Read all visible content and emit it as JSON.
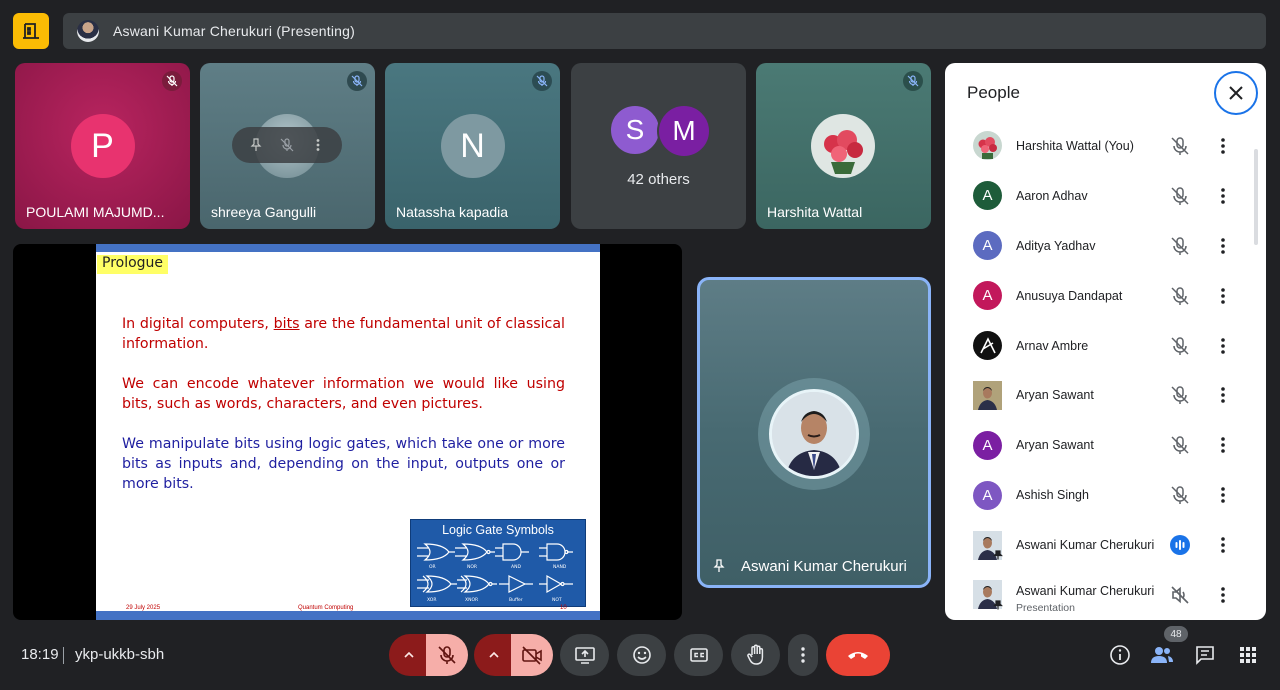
{
  "header": {
    "presenting_label": "Aswani Kumar Cherukuri (Presenting)"
  },
  "tiles": [
    {
      "name": "POULAMI MAJUMD...",
      "initial": "P",
      "bg": "#9c1a4f",
      "avatar_color": "#e8336f"
    },
    {
      "name": "shreeya Gangulli",
      "initial": "",
      "bg": "#4d6a72",
      "avatar_color": "#7a9aa4"
    },
    {
      "name": "Natassha kapadia",
      "initial": "N",
      "bg": "#3f6b75",
      "avatar_color": "#7e99a1"
    },
    {
      "name": "",
      "others_label": "42 others",
      "initials": [
        "S",
        "M"
      ],
      "bg": "#3c4043"
    },
    {
      "name": "Harshita Wattal",
      "bg": "#3e6a66"
    }
  ],
  "slide": {
    "tag": "Prologue",
    "para1": "In digital computers, bits are the fundamental unit of classical information.",
    "para1_pre": "In digital computers, ",
    "para1_bits": "bits",
    "para1_post": " are the fundamental unit of classical information.",
    "para2": "We can encode whatever information we would like using bits, such as words, characters, and even pictures.",
    "para3": "We manipulate bits using logic gates, which take one or more bits as inputs and, depending on the input, outputs one or more bits.",
    "gates_title": "Logic Gate Symbols",
    "gate_labels_row1": [
      "OR",
      "NOR",
      "AND",
      "NAND"
    ],
    "gate_labels_row2": [
      "XOR",
      "XNOR",
      "Buffer",
      "NOT"
    ],
    "footer_date": "29 July 2025",
    "footer_title": "Quantum Computing",
    "footer_page": "10"
  },
  "speaker": {
    "name": "Aswani Kumar Cherukuri"
  },
  "people_panel": {
    "title": "People",
    "participants": [
      {
        "name": "Harshita Wattal (You)",
        "initial": "",
        "avatar": "flowers",
        "color": "#c8d7d0",
        "status": "muted"
      },
      {
        "name": "Aaron Adhav",
        "initial": "A",
        "avatar": "letter",
        "color": "#1e5c3a",
        "status": "muted"
      },
      {
        "name": "Aditya Yadhav",
        "initial": "A",
        "avatar": "letter",
        "color": "#5c6bc0",
        "status": "muted"
      },
      {
        "name": "Anusuya Dandapat",
        "initial": "A",
        "avatar": "letter",
        "color": "#c2185b",
        "status": "muted"
      },
      {
        "name": "Arnav Ambre",
        "initial": "",
        "avatar": "logo",
        "color": "#111111",
        "status": "muted"
      },
      {
        "name": "Aryan Sawant",
        "initial": "",
        "avatar": "photo",
        "color": "#b0a27a",
        "status": "muted"
      },
      {
        "name": "Aryan Sawant",
        "initial": "A",
        "avatar": "letter",
        "color": "#7b1fa2",
        "status": "muted"
      },
      {
        "name": "Ashish Singh",
        "initial": "A",
        "avatar": "letter",
        "color": "#7e57c2",
        "status": "muted"
      },
      {
        "name": "Aswani Kumar Cherukuri",
        "initial": "",
        "avatar": "photo",
        "color": "#d6dfe6",
        "status": "speaking"
      },
      {
        "name": "Aswani Kumar Cherukuri",
        "subtitle": "Presentation",
        "initial": "",
        "avatar": "photo",
        "color": "#d6dfe6",
        "status": "audio-off"
      }
    ]
  },
  "bottom_bar": {
    "time": "18:19",
    "meeting_code": "ykp-ukkb-sbh",
    "participant_count": "48"
  },
  "colors": {
    "accent": "#8ab4f8",
    "end_call": "#ea4335",
    "muted_red": "#f6aea9",
    "logo_yellow": "#fbbc04"
  }
}
